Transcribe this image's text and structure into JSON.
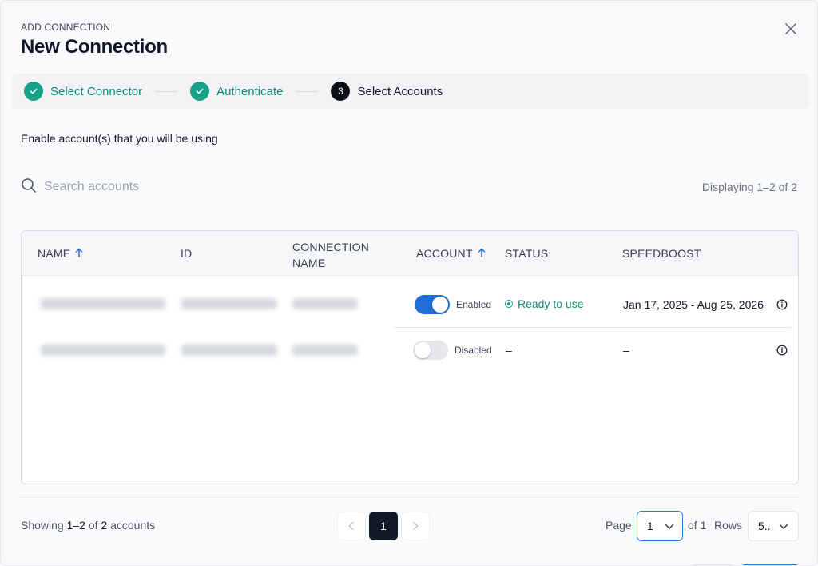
{
  "header": {
    "eyebrow": "ADD CONNECTION",
    "title": "New Connection"
  },
  "stepper": {
    "steps": [
      {
        "label": "Select Connector",
        "state": "done"
      },
      {
        "label": "Authenticate",
        "state": "done"
      },
      {
        "label": "Select Accounts",
        "state": "current",
        "number": "3"
      }
    ]
  },
  "instruction": "Enable account(s) that you will be using",
  "search": {
    "placeholder": "Search accounts",
    "value": ""
  },
  "displaying": "Displaying 1–2 of 2",
  "table": {
    "columns": {
      "name": "NAME",
      "id": "ID",
      "connection_name_line1": "CONNECTION",
      "connection_name_line2": "NAME",
      "account": "ACCOUNT",
      "status": "STATUS",
      "speedboost": "SPEEDBOOST"
    },
    "rows": [
      {
        "account_label": "Enabled",
        "account_enabled": true,
        "status": "Ready to use",
        "speedboost": "Jan 17, 2025 - Aug 25, 2026"
      },
      {
        "account_label": "Disabled",
        "account_enabled": false,
        "status": "–",
        "speedboost": "–"
      }
    ]
  },
  "footer": {
    "showing_prefix": "Showing ",
    "showing_range": "1–2",
    "showing_of": " of ",
    "showing_total": "2",
    "showing_suffix": " accounts",
    "current_page": "1",
    "page_label": "Page",
    "page_value": "1",
    "of_label": "of 1",
    "rows_label": "Rows",
    "rows_value": "5.."
  },
  "icons": {
    "close": "close-icon",
    "check": "check-icon",
    "search": "search-icon",
    "sort": "arrow-up-icon",
    "info": "info-icon",
    "chevron": "chevron-down-icon"
  },
  "colors": {
    "accent_green": "#19a187",
    "toggle_blue": "#1f6fd6",
    "dark": "#111827"
  }
}
